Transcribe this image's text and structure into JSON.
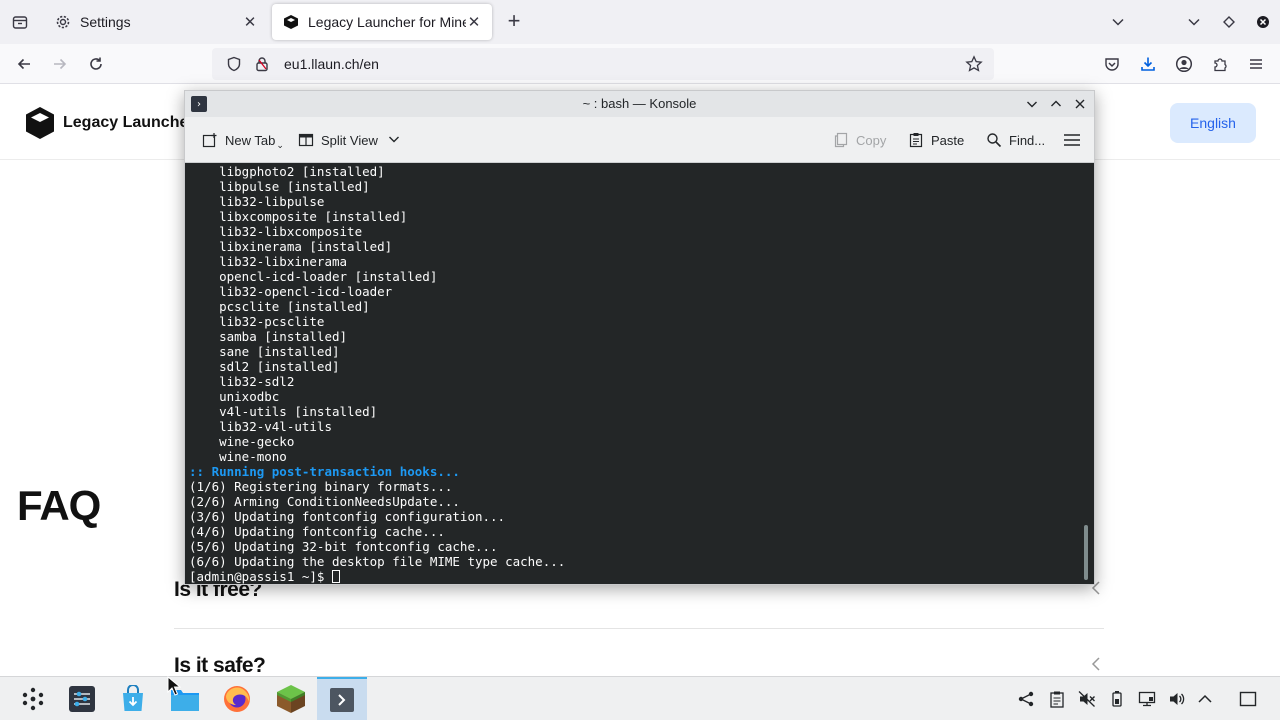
{
  "browser": {
    "tabs": [
      {
        "title": "Settings",
        "icon": "gear-icon"
      },
      {
        "title": "Legacy Launcher for Minec",
        "icon": "launcher-logo-icon"
      }
    ],
    "url": "eu1.llaun.ch/en"
  },
  "site": {
    "name": "Legacy Launcher",
    "language_button": "English",
    "faq_title": "FAQ",
    "faq_items": [
      "Is it free?",
      "Is it safe?"
    ]
  },
  "konsole": {
    "title": "~ : bash — Konsole",
    "toolbar": {
      "new_tab": "New Tab",
      "split_view": "Split View",
      "copy": "Copy",
      "paste": "Paste",
      "find": "Find..."
    },
    "output": [
      "    libgphoto2 [installed]",
      "    libpulse [installed]",
      "    lib32-libpulse",
      "    libxcomposite [installed]",
      "    lib32-libxcomposite",
      "    libxinerama [installed]",
      "    lib32-libxinerama",
      "    opencl-icd-loader [installed]",
      "    lib32-opencl-icd-loader",
      "    pcsclite [installed]",
      "    lib32-pcsclite",
      "    samba [installed]",
      "    sane [installed]",
      "    sdl2 [installed]",
      "    lib32-sdl2",
      "    unixodbc",
      "    v4l-utils [installed]",
      "    lib32-v4l-utils",
      "    wine-gecko",
      "    wine-mono"
    ],
    "hooks_header": ":: Running post-transaction hooks...",
    "hooks": [
      "(1/6) Registering binary formats...",
      "(2/6) Arming ConditionNeedsUpdate...",
      "(3/6) Updating fontconfig configuration...",
      "(4/6) Updating fontconfig cache...",
      "(5/6) Updating 32-bit fontconfig cache...",
      "(6/6) Updating the desktop file MIME type cache..."
    ],
    "prompt": "[admin@passis1 ~]$ "
  },
  "colors": {
    "terminal_bg": "#232627",
    "terminal_fg": "#fcfcfc",
    "hook_blue": "#1d99f3",
    "lang_button_bg": "#dbeafe",
    "lang_button_fg": "#2563eb",
    "taskbar_active": "#c9dcef"
  }
}
